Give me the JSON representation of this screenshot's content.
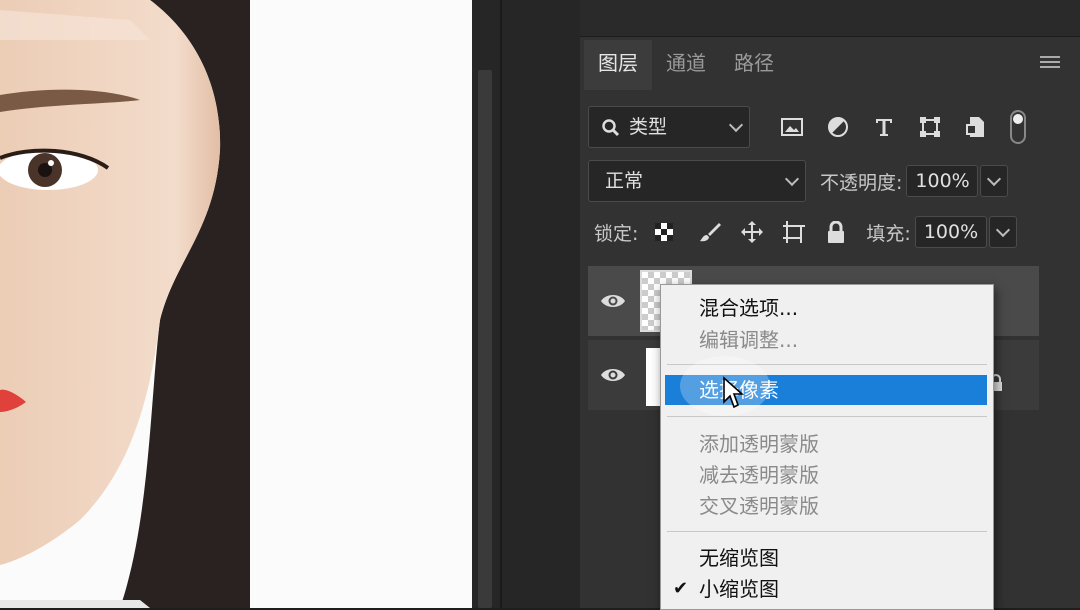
{
  "panel": {
    "tabs": [
      {
        "label": "图层"
      },
      {
        "label": "通道"
      },
      {
        "label": "路径"
      }
    ],
    "filter": {
      "label": "类型"
    },
    "blend_mode": "正常",
    "opacity": {
      "label": "不透明度:",
      "value": "100%"
    },
    "lock": {
      "label": "锁定:"
    },
    "fill": {
      "label": "填充:",
      "value": "100%"
    }
  },
  "context_menu": {
    "items": [
      {
        "label": "混合选项..."
      },
      {
        "label": "编辑调整..."
      },
      {
        "label": "选择像素"
      },
      {
        "label": "添加透明蒙版"
      },
      {
        "label": "减去透明蒙版"
      },
      {
        "label": "交叉透明蒙版"
      },
      {
        "label": "无缩览图"
      },
      {
        "label": "小缩览图"
      }
    ]
  },
  "colors": {
    "panel_bg": "#323232",
    "highlight": "#1a7fd9"
  }
}
